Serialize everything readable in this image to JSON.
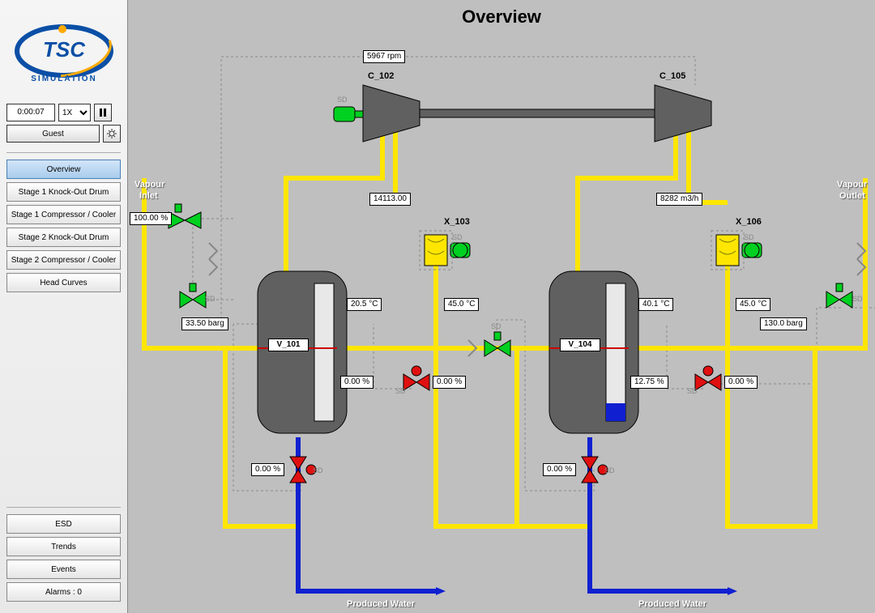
{
  "title": "Overview",
  "logo_text_top": "TSC",
  "logo_text_bottom": "SIMULATION",
  "time": "0:00:07",
  "speed": "1X",
  "user": "Guest",
  "nav": {
    "overview": "Overview",
    "s1ko": "Stage 1 Knock-Out Drum",
    "s1cc": "Stage 1 Compressor / Cooler",
    "s2ko": "Stage 2 Knock-Out Drum",
    "s2cc": "Stage 2 Compressor / Cooler",
    "head": "Head Curves"
  },
  "bottom": {
    "esd": "ESD",
    "trends": "Trends",
    "events": "Events",
    "alarms": "Alarms : 0"
  },
  "labels": {
    "vapour_inlet_1": "Vapour",
    "vapour_inlet_2": "Inlet",
    "vapour_outlet_1": "Vapour",
    "vapour_outlet_2": "Outlet",
    "c102": "C_102",
    "c105": "C_105",
    "x103": "X_103",
    "x106": "X_106",
    "v101": "V_101",
    "v104": "V_104",
    "pw1": "Produced Water",
    "pw2": "Produced Water",
    "sd": "SD"
  },
  "tags": {
    "rpm": "5967 rpm",
    "inlet_pct": "100.00 %",
    "barg1": "33.50 barg",
    "mass1": "14113.00",
    "vol2": "8282 m3/h",
    "t_v101": "20.5 °C",
    "t_x103": "45.0 °C",
    "t_v104": "40.1 °C",
    "t_x106": "45.0 °C",
    "barg2": "130.0 barg",
    "lvl_v101": "0.00 %",
    "lvl_x103": "0.00 %",
    "lvl_v104": "12.75 %",
    "lvl_x106": "0.00 %",
    "drain1": "0.00 %",
    "drain2": "0.00 %"
  },
  "colors": {
    "vapour": "#FFE600",
    "water": "#1020D0",
    "motor": "#00D020",
    "drum": "#606060",
    "red": "#E01010"
  }
}
